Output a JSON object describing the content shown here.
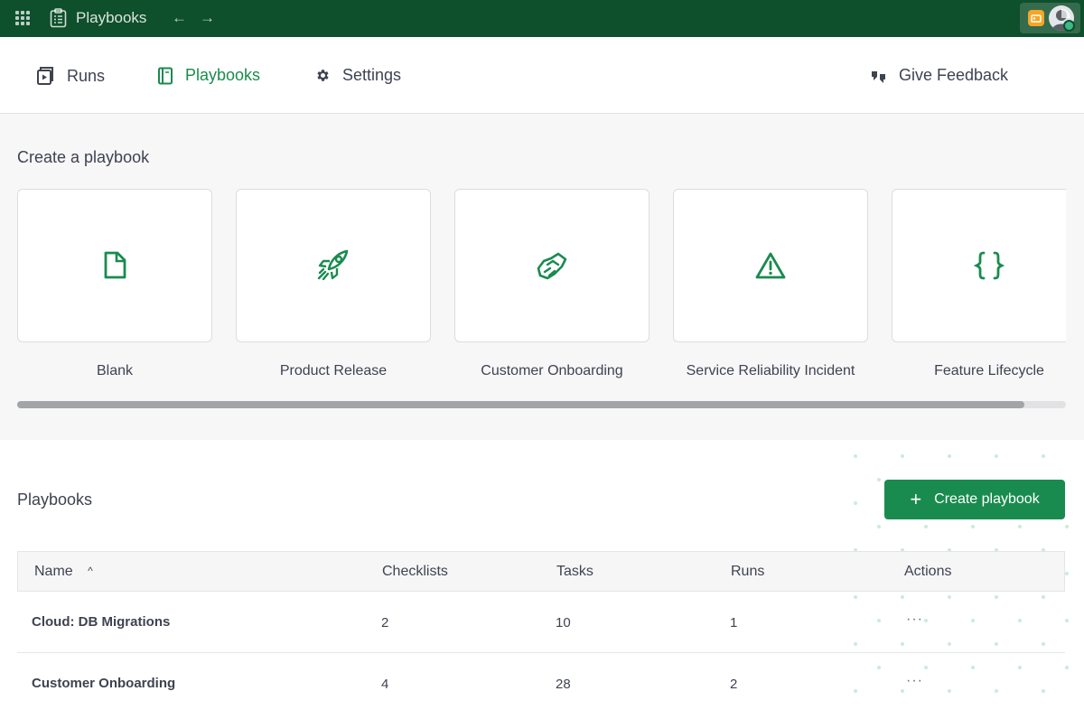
{
  "topbar": {
    "app_title": "Playbooks",
    "back_arrow": "←",
    "forward_arrow": "→",
    "icons": [
      "product-menu-icon",
      "clipboard-icon",
      "plugin-icon",
      "avatar"
    ]
  },
  "nav": {
    "items": [
      {
        "label": "Runs",
        "icon": "clipboard-play-icon",
        "active": false
      },
      {
        "label": "Playbooks",
        "icon": "notebook-icon",
        "active": true
      },
      {
        "label": "Settings",
        "icon": "gear-icon",
        "active": false
      }
    ],
    "feedback_label": "Give Feedback"
  },
  "templates": {
    "title": "Create a playbook",
    "cards": [
      {
        "label": "Blank",
        "icon": "file-icon"
      },
      {
        "label": "Product Release",
        "icon": "rocket-icon"
      },
      {
        "label": "Customer Onboarding",
        "icon": "handshake-icon"
      },
      {
        "label": "Service Reliability Incident",
        "icon": "alert-triangle-icon"
      },
      {
        "label": "Feature Lifecycle",
        "icon": "code-braces-icon"
      }
    ]
  },
  "playbooks": {
    "title": "Playbooks",
    "create_label": "Create playbook",
    "create_plus": "+",
    "columns": {
      "name": "Name",
      "sort_indicator": "^",
      "checklists": "Checklists",
      "tasks": "Tasks",
      "runs": "Runs",
      "actions": "Actions"
    },
    "rows": [
      {
        "name": "Cloud: DB Migrations",
        "checklists": "2",
        "tasks": "10",
        "runs": "1",
        "actions": "···"
      },
      {
        "name": "Customer Onboarding",
        "checklists": "4",
        "tasks": "28",
        "runs": "2",
        "actions": "···"
      }
    ]
  },
  "colors": {
    "topbar": "#0e4f2c",
    "accent": "#1a8b4f",
    "text": "#3f4350"
  }
}
